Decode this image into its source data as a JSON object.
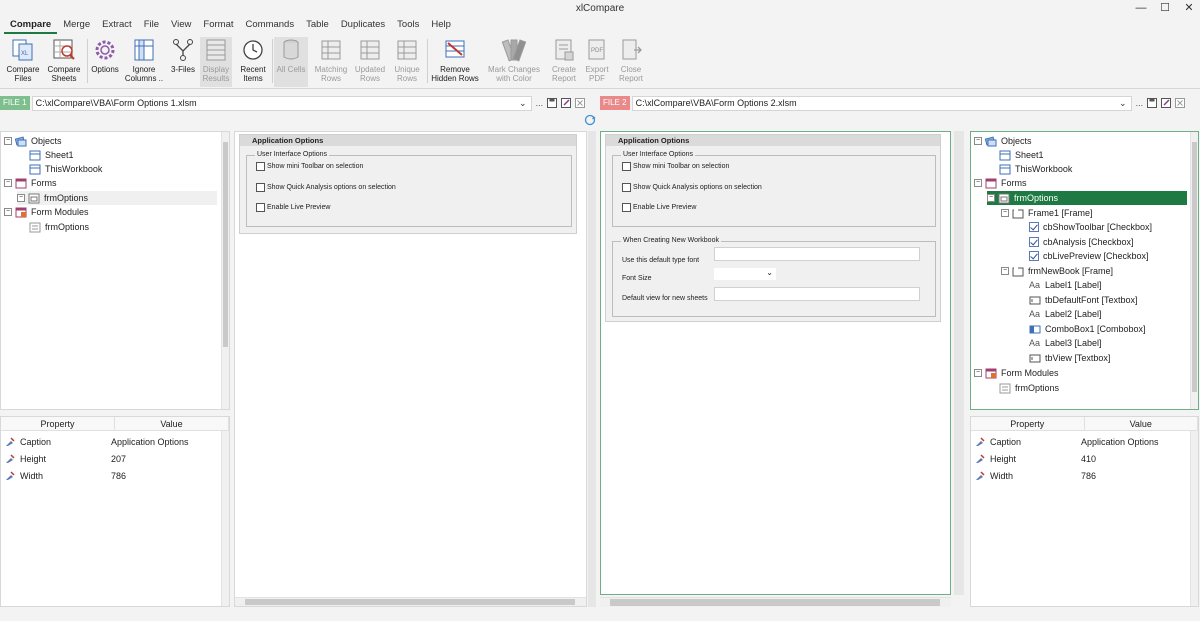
{
  "window": {
    "title": "xlCompare",
    "controls": [
      "—",
      "☐",
      "✕"
    ]
  },
  "menu": [
    "Compare",
    "Merge",
    "Extract",
    "File",
    "View",
    "Format",
    "Commands",
    "Table",
    "Duplicates",
    "Tools",
    "Help"
  ],
  "ribbon": [
    {
      "label": "Compare\nFiles",
      "icon": "compare-files-icon"
    },
    {
      "label": "Compare\nSheets",
      "icon": "compare-sheets-icon"
    },
    {
      "label": "Options",
      "icon": "gear-icon"
    },
    {
      "label": "Ignore\nColumns ..",
      "icon": "ignore-columns-icon"
    },
    {
      "label": "3-Files",
      "icon": "three-files-icon"
    },
    {
      "label": "Display\nResults",
      "icon": "display-results-icon"
    },
    {
      "label": "Recent\nItems",
      "icon": "clock-icon"
    },
    {
      "label": "All Cells",
      "icon": "all-cells-icon"
    },
    {
      "label": "Matching\nRows",
      "icon": "matching-rows-icon"
    },
    {
      "label": "Updated\nRows",
      "icon": "updated-rows-icon"
    },
    {
      "label": "Unique\nRows",
      "icon": "unique-rows-icon"
    },
    {
      "label": "Remove\nHidden Rows",
      "icon": "remove-hidden-rows-icon"
    },
    {
      "label": "Mark Changes\nwith Color",
      "icon": "color-swatch-icon"
    },
    {
      "label": "Create\nReport",
      "icon": "create-report-icon"
    },
    {
      "label": "Export\nPDF",
      "icon": "export-pdf-icon"
    },
    {
      "label": "Close\nReport",
      "icon": "close-report-icon"
    }
  ],
  "file1": {
    "tag": "FILE 1",
    "path": "C:\\xlCompare\\VBA\\Form Options 1.xlsm",
    "browse": "..."
  },
  "file2": {
    "tag": "FILE 2",
    "path": "C:\\xlCompare\\VBA\\Form Options 2.xlsm",
    "browse": "..."
  },
  "tree1": [
    {
      "label": "Objects"
    },
    {
      "label": "Sheet1"
    },
    {
      "label": "ThisWorkbook"
    },
    {
      "label": "Forms"
    },
    {
      "label": "frmOptions"
    },
    {
      "label": "Form Modules"
    },
    {
      "label": "frmOptions"
    }
  ],
  "tree2": [
    {
      "label": "Objects"
    },
    {
      "label": "Sheet1"
    },
    {
      "label": "ThisWorkbook"
    },
    {
      "label": "Forms"
    },
    {
      "label": "frmOptions"
    },
    {
      "label": "Frame1 [Frame]"
    },
    {
      "label": "cbShowToolbar [Checkbox]"
    },
    {
      "label": "cbAnalysis [Checkbox]"
    },
    {
      "label": "cbLivePreview [Checkbox]"
    },
    {
      "label": "frmNewBook [Frame]"
    },
    {
      "label": "Label1 [Label]"
    },
    {
      "label": "tbDefaultFont [Textbox]"
    },
    {
      "label": "Label2 [Label]"
    },
    {
      "label": "ComboBox1 [Combobox]"
    },
    {
      "label": "Label3 [Label]"
    },
    {
      "label": "tbView [Textbox]"
    },
    {
      "label": "Form Modules"
    },
    {
      "label": "frmOptions"
    }
  ],
  "props_header": {
    "property": "Property",
    "value": "Value"
  },
  "props1": [
    {
      "name": "Caption",
      "value": "Application Options"
    },
    {
      "name": "Height",
      "value": "207"
    },
    {
      "name": "Width",
      "value": "786"
    }
  ],
  "props2": [
    {
      "name": "Caption",
      "value": "Application Options"
    },
    {
      "name": "Height",
      "value": "410"
    },
    {
      "name": "Width",
      "value": "786"
    }
  ],
  "form1": {
    "title": "Application Options",
    "frame_caption": "User Interface Options",
    "checks": [
      "Show mini Toolbar on selection",
      "Show Quick Analysis options on selection",
      "Enable Live Preview"
    ]
  },
  "form2": {
    "title": "Application Options",
    "frame_caption": "User Interface Options",
    "checks": [
      "Show mini Toolbar on selection",
      "Show Quick Analysis options on selection",
      "Enable Live Preview"
    ],
    "frame2_caption": "When Creating New Workbook",
    "labels": [
      "Use this default type font",
      "Font Size",
      "Default view for new sheets"
    ]
  },
  "aa_glyph": "Aa",
  "expand": {
    "minus": "−"
  }
}
